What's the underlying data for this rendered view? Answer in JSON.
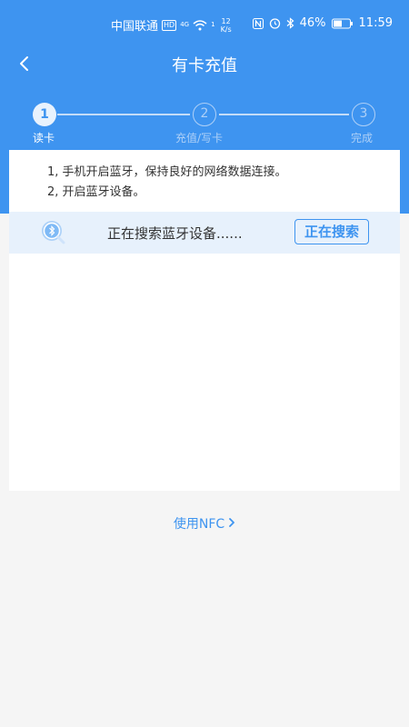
{
  "status_bar": {
    "carrier": "中国联通",
    "hd_badge": "HD",
    "network": "4G",
    "wifi_index": "1",
    "speed_value": "12",
    "speed_unit": "K/s",
    "battery_percent": "46%",
    "time": "11:59"
  },
  "nav": {
    "title": "有卡充值"
  },
  "steps": [
    {
      "number": "1",
      "label": "读卡",
      "state": "active"
    },
    {
      "number": "2",
      "label": "充值/写卡",
      "state": "inactive"
    },
    {
      "number": "3",
      "label": "完成",
      "state": "inactive"
    }
  ],
  "instructions": [
    "1, 手机开启蓝牙，保持良好的网络数据连接。",
    "2, 开启蓝牙设备。"
  ],
  "search": {
    "status_text": "正在搜索蓝牙设备......",
    "button_label": "正在搜索"
  },
  "nfc": {
    "label": "使用NFC"
  },
  "colors": {
    "primary": "#3e94f0",
    "search_row_bg": "#e7f1fc",
    "page_bg": "#f5f5f5"
  }
}
